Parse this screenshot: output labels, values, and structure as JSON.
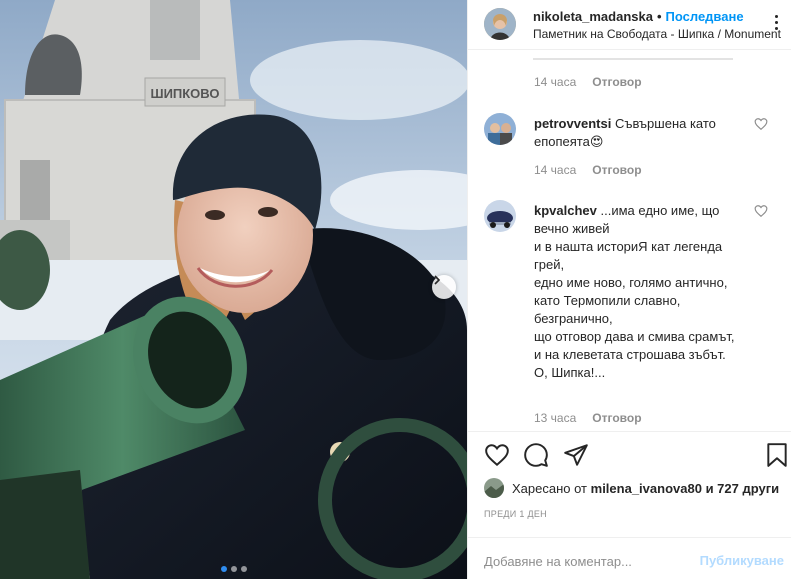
{
  "post": {
    "photo": {
      "alt_icon": "cannon-photo",
      "monument_inscription": "ШИПКОВО",
      "carousel_dots": 3,
      "carousel_active": 0
    }
  },
  "header": {
    "username": "nikoleta_madanska",
    "separator": "•",
    "follow_label": "Последване",
    "location": "Паметник на Свободата - Шипка / Monument"
  },
  "comments": [
    {
      "time": "14 часа",
      "reply": "Отговор"
    },
    {
      "user": "petrovventsi",
      "text": "Съвършена като епопеята😍",
      "time": "14 часа",
      "reply": "Отговор"
    },
    {
      "user": "kpvalchev",
      "text": "...има едно име, що вечно живей\nи в нашта историЯ кат легенда грей,\nедно име ново, голямо антично,\nкато Термопили славно, безгранично,\nщо отговор дава и смива срамът,\nи на клеветата строшава зъбът.\nО, Шипка!...",
      "time": "13 часа",
      "reply": "Отговор"
    }
  ],
  "likes": {
    "prefix": "Харесано от",
    "user": "milena_ivanova80",
    "suffix": "и 727 други"
  },
  "date_label": "ПРЕДИ 1 ДЕН",
  "add_comment": {
    "placeholder": "Добавяне на коментар...",
    "post_label": "Публикуване"
  },
  "colors": {
    "link": "#0095f6",
    "muted": "#8e8e8e",
    "post_disabled": "#b3dbff",
    "dot_active": "#2f8cf0"
  }
}
